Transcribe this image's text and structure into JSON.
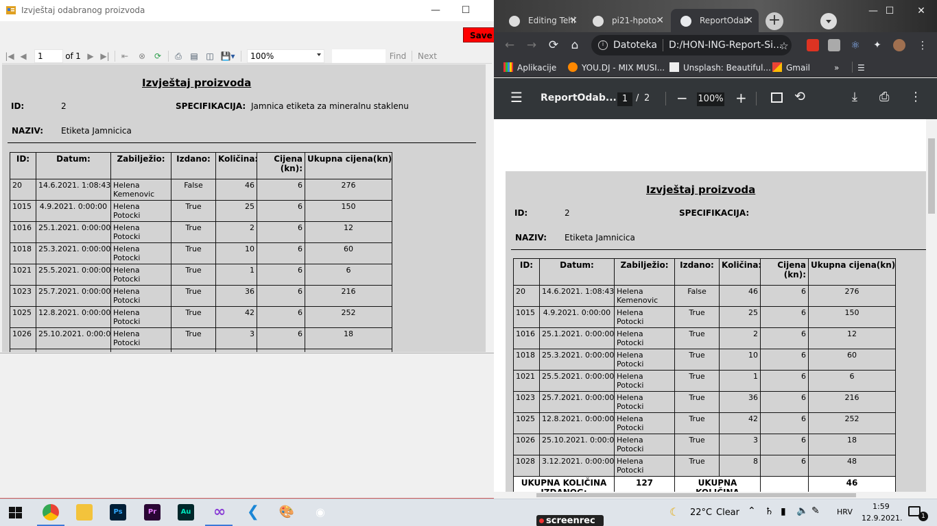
{
  "left_window": {
    "title": "Izvještaj odabranog proizvoda",
    "save_label": "Save F",
    "toolbar": {
      "page_value": "1",
      "of_label": "of",
      "total_pages": "1",
      "zoom": "100%",
      "find_label": "Find",
      "next_label": "Next"
    }
  },
  "report": {
    "title": "Izvještaj proizvoda",
    "id_label": "ID:",
    "id_value": "2",
    "spec_label": "SPECIFIKACIJA:",
    "spec_value_left": "Jamnica etiketa za mineralnu staklenu",
    "spec_value_right": "",
    "naziv_label": "NAZIV:",
    "naziv_value": "Etiketa Jamnicica",
    "columns": [
      "ID:",
      "Datum:",
      "Zabilježio:",
      "Izdano:",
      "Količina:",
      "Cijena (kn):",
      "Ukupna cijena(kn):"
    ],
    "rows": [
      {
        "id": "20",
        "datum": "14.6.2021. 1:08:43",
        "zabiljezio": "Helena Kemenovic",
        "izdano": "False",
        "kolicina": "46",
        "cijena": "6",
        "ukupno": "276"
      },
      {
        "id": "1015",
        "datum": "4.9.2021. 0:00:00",
        "zabiljezio": "Helena Potocki",
        "izdano": "True",
        "kolicina": "25",
        "cijena": "6",
        "ukupno": "150"
      },
      {
        "id": "1016",
        "datum": "25.1.2021. 0:00:00",
        "zabiljezio": "Helena Potocki",
        "izdano": "True",
        "kolicina": "2",
        "cijena": "6",
        "ukupno": "12"
      },
      {
        "id": "1018",
        "datum": "25.3.2021. 0:00:00",
        "zabiljezio": "Helena Potocki",
        "izdano": "True",
        "kolicina": "10",
        "cijena": "6",
        "ukupno": "60"
      },
      {
        "id": "1021",
        "datum": "25.5.2021. 0:00:00",
        "zabiljezio": "Helena Potocki",
        "izdano": "True",
        "kolicina": "1",
        "cijena": "6",
        "ukupno": "6"
      },
      {
        "id": "1023",
        "datum": "25.7.2021. 0:00:00",
        "zabiljezio": "Helena Potocki",
        "izdano": "True",
        "kolicina": "36",
        "cijena": "6",
        "ukupno": "216"
      },
      {
        "id": "1025",
        "datum": "12.8.2021. 0:00:00",
        "zabiljezio": "Helena Potocki",
        "izdano": "True",
        "kolicina": "42",
        "cijena": "6",
        "ukupno": "252"
      },
      {
        "id": "1026",
        "datum": "25.10.2021. 0:00:00",
        "zabiljezio": "Helena Potocki",
        "izdano": "True",
        "kolicina": "3",
        "cijena": "6",
        "ukupno": "18"
      },
      {
        "id": "1028",
        "datum": "3.12.2021. 0:00:00",
        "zabiljezio": "Helena Potocki",
        "izdano": "True",
        "kolicina": "8",
        "cijena": "6",
        "ukupno": "48"
      }
    ],
    "totals": {
      "izdano_label": "UKUPNA KOLIČINA IZDANOG:",
      "izdano_value": "127",
      "neizdano_label": "UKUPNA KOLIČINA NEIZDANIH:",
      "neizdano_value": "46"
    }
  },
  "browser": {
    "tabs": [
      {
        "label": "Editing Tehi"
      },
      {
        "label": "pi21-hpoto"
      },
      {
        "label": "ReportOdab"
      }
    ],
    "omnibox_scheme": "Datoteka",
    "omnibox_url": "D:/HON-ING-Report-Si...",
    "bookmarks": [
      {
        "label": "Aplikacije"
      },
      {
        "label": "YOU.DJ - MIX MUSI..."
      },
      {
        "label": "Unsplash: Beautiful..."
      },
      {
        "label": "Gmail"
      }
    ],
    "pdf": {
      "doc_title": "ReportOdab...",
      "page_current": "1",
      "page_sep": "/",
      "page_total": "2",
      "zoom": "100%"
    }
  },
  "taskbar": {
    "weather_temp": "22°C",
    "weather_text": "Clear",
    "language": "HRV",
    "time": "1:59",
    "date": "12.9.2021.",
    "notification_count": "1",
    "screenrec_label": "screenrec"
  },
  "colors": {
    "report_bg": "#d3d3d3",
    "save_button": "#ff0000",
    "chrome_dark": "#35363a",
    "pdf_toolbar": "#323639"
  }
}
